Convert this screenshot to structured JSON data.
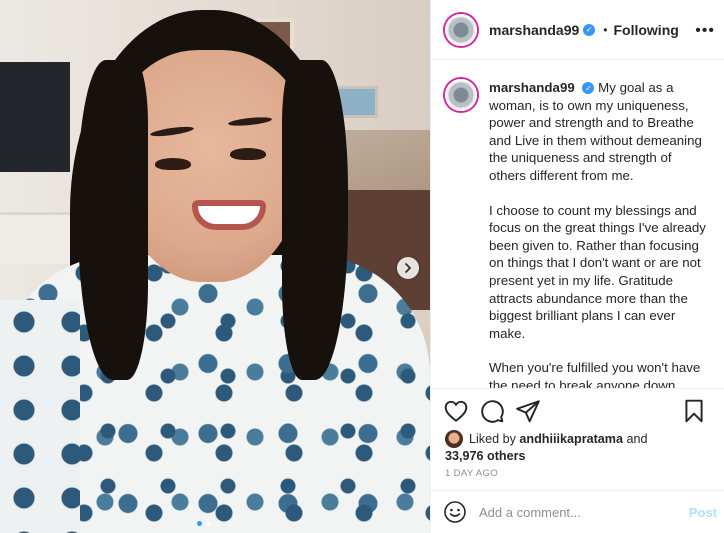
{
  "header": {
    "username": "marshanda99",
    "separator": "•",
    "follow_status": "Following",
    "more_icon": "more-icon"
  },
  "caption": {
    "username": "marshanda99",
    "paragraphs": [
      "My goal as a woman, is to own my uniqueness, power and strength and to Breathe and Live in them without demeaning the uniqueness and strength of others different from me.",
      "I choose to count my blessings and focus on the great things I've already been given to. Rather than focusing on things that I don't want or are not present yet in my life. Gratitude attracts abundance more than the biggest brilliant plans I can ever make.",
      "When you're fulfilled you won't have the need to break anyone down, you'd be happy to support others on their struggles and journey. Because"
    ]
  },
  "actions": {
    "like_icon": "heart-icon",
    "comment_icon": "comment-icon",
    "share_icon": "share-icon",
    "save_icon": "bookmark-icon"
  },
  "likes": {
    "prefix": "Liked by",
    "user": "andhiiikapratama",
    "conjunction": "and",
    "count": "33,976 others"
  },
  "timestamp": "1 DAY AGO",
  "comment": {
    "placeholder": "Add a comment...",
    "post_label": "Post"
  },
  "carousel": {
    "next_icon": "chevron-right-icon",
    "current_slide": 1,
    "total_slides": 2
  },
  "colors": {
    "verified": "#3897f0",
    "text": "#262626",
    "muted": "#8e8e8e",
    "post_disabled": "#b2dffc",
    "active_dot": "#3897f0"
  }
}
